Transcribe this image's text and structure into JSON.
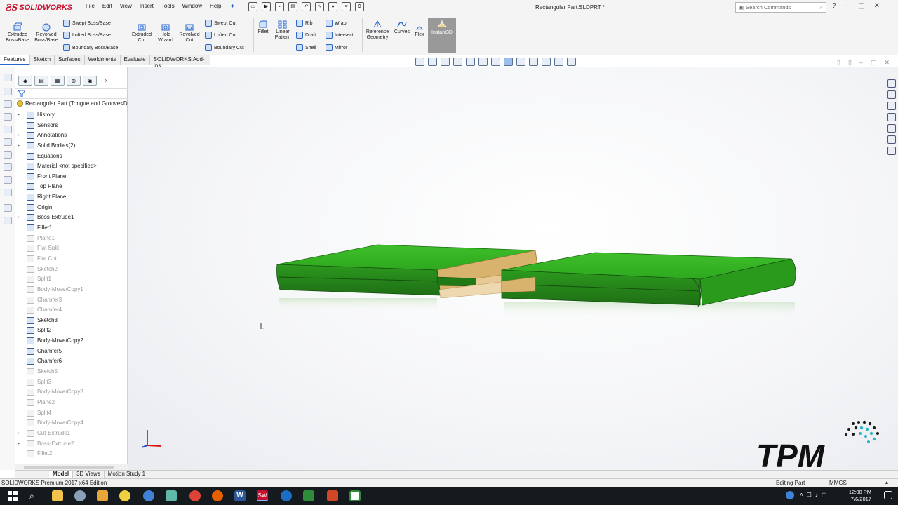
{
  "app": {
    "brand": "SOLIDWORKS",
    "document_title": "Rectangular Part.SLDPRT *"
  },
  "menu": [
    "File",
    "Edit",
    "View",
    "Insert",
    "Tools",
    "Window",
    "Help"
  ],
  "search": {
    "placeholder": "Search Commands"
  },
  "ribbon": {
    "extruded_boss": "Extruded Boss/Base",
    "revolved_boss": "Revolved Boss/Base",
    "swept_boss": "Swept Boss/Base",
    "lofted_boss": "Lofted Boss/Base",
    "boundary_boss": "Boundary Boss/Base",
    "extruded_cut": "Extruded Cut",
    "hole_wizard": "Hole Wizard",
    "revolved_cut": "Revolved Cut",
    "swept_cut": "Swept Cut",
    "lofted_cut": "Lofted Cut",
    "boundary_cut": "Boundary Cut",
    "fillet": "Fillet",
    "linear_pattern": "Linear Pattern",
    "rib": "Rib",
    "draft": "Draft",
    "shell": "Shell",
    "wrap": "Wrap",
    "intersect": "Intersect",
    "mirror": "Mirror",
    "reference_geometry": "Reference Geometry",
    "curves": "Curves",
    "flex": "Flex",
    "instant3d": "Instant3D"
  },
  "command_tabs": [
    "Features",
    "Sketch",
    "Surfaces",
    "Weldments",
    "Evaluate",
    "SOLIDWORKS Add-Ins"
  ],
  "tree": {
    "root": "Rectangular Part  (Tongue and Groove<D",
    "items": [
      {
        "label": "History",
        "expandable": true,
        "suppressed": false
      },
      {
        "label": "Sensors",
        "expandable": false,
        "suppressed": false
      },
      {
        "label": "Annotations",
        "expandable": true,
        "suppressed": false
      },
      {
        "label": "Solid Bodies(2)",
        "expandable": true,
        "suppressed": false
      },
      {
        "label": "Equations",
        "expandable": false,
        "suppressed": false
      },
      {
        "label": "Material <not specified>",
        "expandable": false,
        "suppressed": false
      },
      {
        "label": "Front Plane",
        "expandable": false,
        "suppressed": false
      },
      {
        "label": "Top Plane",
        "expandable": false,
        "suppressed": false
      },
      {
        "label": "Right Plane",
        "expandable": false,
        "suppressed": false
      },
      {
        "label": "Origin",
        "expandable": false,
        "suppressed": false
      },
      {
        "label": "Boss-Extrude1",
        "expandable": true,
        "suppressed": false
      },
      {
        "label": "Fillet1",
        "expandable": false,
        "suppressed": false
      },
      {
        "label": "Plane1",
        "expandable": false,
        "suppressed": true
      },
      {
        "label": "Flat Split",
        "expandable": false,
        "suppressed": true
      },
      {
        "label": "Flat Cut",
        "expandable": false,
        "suppressed": true
      },
      {
        "label": "Sketch2",
        "expandable": false,
        "suppressed": true
      },
      {
        "label": "Split1",
        "expandable": false,
        "suppressed": true
      },
      {
        "label": "Body-Move/Copy1",
        "expandable": false,
        "suppressed": true
      },
      {
        "label": "Chamfer3",
        "expandable": false,
        "suppressed": true
      },
      {
        "label": "Chamfer4",
        "expandable": false,
        "suppressed": true
      },
      {
        "label": "Sketch3",
        "expandable": false,
        "suppressed": false
      },
      {
        "label": "Split2",
        "expandable": false,
        "suppressed": false
      },
      {
        "label": "Body-Move/Copy2",
        "expandable": false,
        "suppressed": false
      },
      {
        "label": "Chamfer5",
        "expandable": false,
        "suppressed": false
      },
      {
        "label": "Chamfer6",
        "expandable": false,
        "suppressed": false
      },
      {
        "label": "Sketch5",
        "expandable": false,
        "suppressed": true
      },
      {
        "label": "Split3",
        "expandable": false,
        "suppressed": true
      },
      {
        "label": "Body-Move/Copy3",
        "expandable": false,
        "suppressed": true
      },
      {
        "label": "Plane2",
        "expandable": false,
        "suppressed": true
      },
      {
        "label": "Split4",
        "expandable": false,
        "suppressed": true
      },
      {
        "label": "Body-Move/Copy4",
        "expandable": false,
        "suppressed": true
      },
      {
        "label": "Cut-Extrude1",
        "expandable": true,
        "suppressed": true
      },
      {
        "label": "Boss-Extrude2",
        "expandable": true,
        "suppressed": true
      },
      {
        "label": "Fillet2",
        "expandable": false,
        "suppressed": true
      }
    ]
  },
  "bottom_tabs": [
    "Model",
    "3D Views",
    "Motion Study 1"
  ],
  "status": {
    "left": "SOLIDWORKS Premium 2017 x64 Edition",
    "mode": "Editing Part",
    "units": "MMGS"
  },
  "clock": {
    "time": "12:08 PM",
    "date": "7/6/2017"
  },
  "watermark": {
    "text": "TPM"
  },
  "colors": {
    "body_green": "#2ea81f",
    "tongue_tan": "#d8b36e",
    "accent": "#2a66c8",
    "brand_red": "#c8102e"
  }
}
